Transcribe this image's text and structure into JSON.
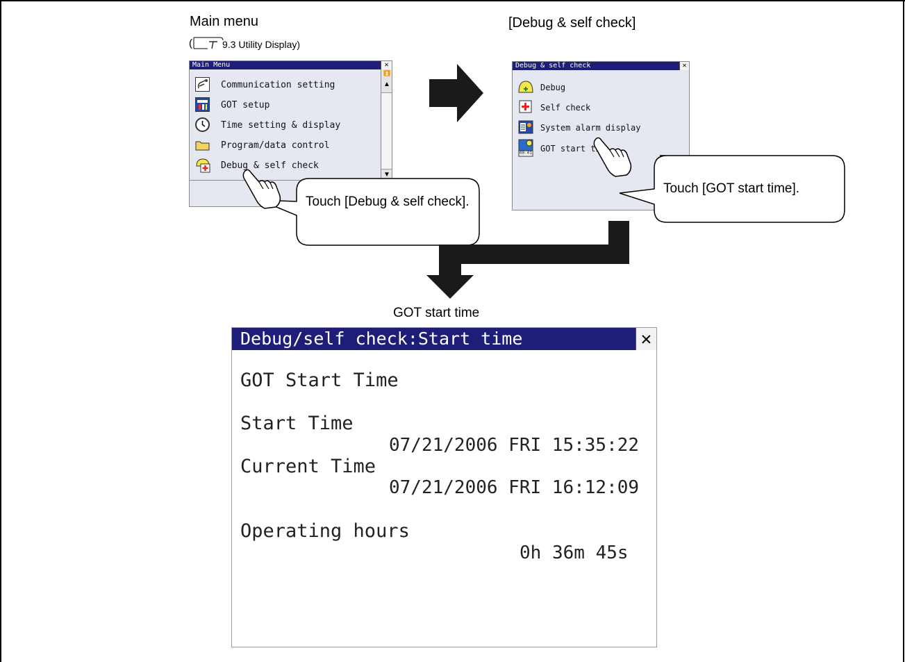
{
  "captions": {
    "main_menu": "Main menu",
    "ref_text": "9.3 Utility Display)",
    "ref_open": "(",
    "debug_self_check": "[Debug & self check]",
    "got_start_time": "GOT start time"
  },
  "main_menu_window": {
    "title": "Main Menu",
    "close": "✕",
    "items": [
      {
        "label": "Communication setting",
        "icon": "communication-setting-icon"
      },
      {
        "label": "GOT setup",
        "icon": "got-setup-icon"
      },
      {
        "label": "Time setting & display",
        "icon": "clock-icon"
      },
      {
        "label": "Program/data control",
        "icon": "folder-icon"
      },
      {
        "label": "Debug & self check",
        "icon": "debug-self-check-icon"
      }
    ],
    "scroll_top": "⏫",
    "scroll_up": "▲",
    "scroll_down": "▼"
  },
  "debug_window": {
    "title": "Debug & self check",
    "close": "✕",
    "items": [
      {
        "label": "Debug",
        "icon": "debug-icon"
      },
      {
        "label": "Self check",
        "icon": "self-check-icon"
      },
      {
        "label": "System alarm display",
        "icon": "system-alarm-icon"
      },
      {
        "label": "GOT start tim",
        "icon": "got-start-time-icon",
        "icon_text": "00:01"
      }
    ]
  },
  "callouts": {
    "touch_debug": "Touch [Debug & self check].",
    "touch_got": "Touch [GOT start time]."
  },
  "start_time_window": {
    "title": "Debug/self check:Start time",
    "close": "✕",
    "heading": "GOT Start Time",
    "start_label": "Start Time",
    "start_value": "07/21/2006 FRI 15:35:22",
    "current_label": "Current Time",
    "current_value": "07/21/2006 FRI 16:12:09",
    "operating_label": "Operating hours",
    "operating_value": "0h 36m 45s"
  },
  "colors": {
    "title_bar": "#1e1e78",
    "window_bg": "#e6e8f1"
  }
}
